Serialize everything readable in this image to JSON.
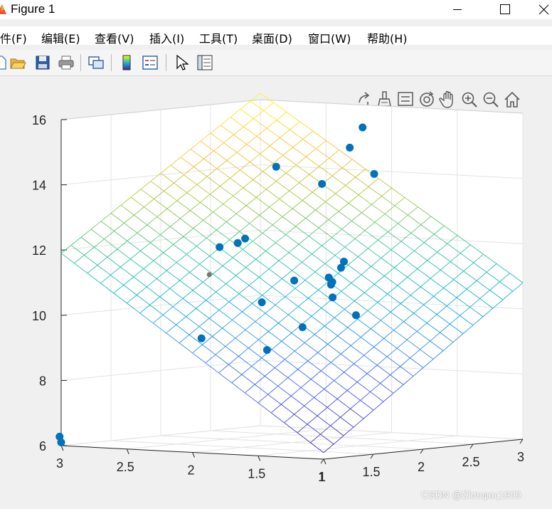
{
  "window": {
    "title": "Figure 1",
    "icon": "matlab-icon"
  },
  "menu": [
    {
      "label": "文件(F)"
    },
    {
      "label": "编辑(E)"
    },
    {
      "label": "查看(V)"
    },
    {
      "label": "插入(I)"
    },
    {
      "label": "工具(T)"
    },
    {
      "label": "桌面(D)"
    },
    {
      "label": "窗口(W)"
    },
    {
      "label": "帮助(H)"
    }
  ],
  "toolbar": [
    "new-figure-icon",
    "open-icon",
    "save-icon",
    "print-icon",
    "link-plot-icon",
    "colorbar-icon",
    "legend-icon",
    "edit-pointer-icon",
    "property-inspector-icon"
  ],
  "axes_toolbar": [
    "export-icon",
    "brush-icon",
    "data-tips-icon",
    "rotate-3d-icon",
    "pan-icon",
    "zoom-in-icon",
    "zoom-out-icon",
    "home-icon"
  ],
  "colors": {
    "marker": "#0072bd",
    "colormap": "parula"
  },
  "watermark": "CSDN @Σίσυφος1900",
  "chart_data": {
    "type": "surface+scatter3",
    "title": "",
    "xlabel": "",
    "ylabel": "",
    "zlabel": "",
    "xlim": [
      1,
      3
    ],
    "ylim": [
      1,
      3
    ],
    "zlim": [
      6,
      16
    ],
    "xticks": [
      1,
      1.5,
      2,
      2.5,
      3
    ],
    "xtick_labels": [
      "1",
      "1.5",
      "2",
      "2.5",
      "3"
    ],
    "yticks": [
      1,
      1.5,
      2,
      2.5,
      3
    ],
    "ytick_labels": [
      "1",
      "1.5",
      "2",
      "2.5",
      "3"
    ],
    "zticks": [
      6,
      8,
      10,
      12,
      14,
      16
    ],
    "ztick_labels": [
      "6",
      "8",
      "10",
      "12",
      "14",
      "16"
    ],
    "grid": true,
    "surface": {
      "kind": "mesh",
      "z_at_corners": {
        "x1_y1": 6.2,
        "x3_y1": 10.8,
        "x1_y3": 11.9,
        "x3_y3": 16.2
      },
      "grid_lines_per_axis": 21
    },
    "points": [
      {
        "x": 2.5,
        "y": 2.5,
        "z": 14.2
      },
      {
        "x": 2.59,
        "y": 1.91,
        "z": 15.5
      },
      {
        "x": 2.29,
        "y": 1.78,
        "z": 15.0
      },
      {
        "x": 2.14,
        "y": 1.48,
        "z": 14.3
      },
      {
        "x": 2.38,
        "y": 2.06,
        "z": 13.8
      },
      {
        "x": 1.85,
        "y": 2.3,
        "z": 12.1
      },
      {
        "x": 2.38,
        "y": 2.84,
        "z": 11.7
      },
      {
        "x": 1.74,
        "y": 2.16,
        "z": 12.3
      },
      {
        "x": 1.93,
        "y": 1.93,
        "z": 11.0
      },
      {
        "x": 2.06,
        "y": 1.65,
        "z": 11.6
      },
      {
        "x": 1.86,
        "y": 1.52,
        "z": 11.5
      },
      {
        "x": 1.46,
        "y": 1.82,
        "z": 10.5
      },
      {
        "x": 2.01,
        "y": 1.52,
        "z": 10.0
      },
      {
        "x": 1.46,
        "y": 1.51,
        "z": 9.8
      },
      {
        "x": 1.38,
        "y": 1.22,
        "z": 10.8
      },
      {
        "x": 1.17,
        "y": 1.09,
        "z": 11.5
      },
      {
        "x": 1.46,
        "y": 2.28,
        "z": 9.3
      },
      {
        "x": 1.13,
        "y": 1.53,
        "z": 9.2
      },
      {
        "x": 1.14,
        "y": 1.05,
        "z": 11.3
      },
      {
        "x": 1.1,
        "y": 1.01,
        "z": 11.4
      },
      {
        "x": 1.05,
        "y": 3.05,
        "z": 6.25
      },
      {
        "x": 1.0,
        "y": 3.0,
        "z": 6.1
      }
    ],
    "highlight_point": {
      "x": 2.25,
      "y": 2.82,
      "z": 10.9
    }
  }
}
